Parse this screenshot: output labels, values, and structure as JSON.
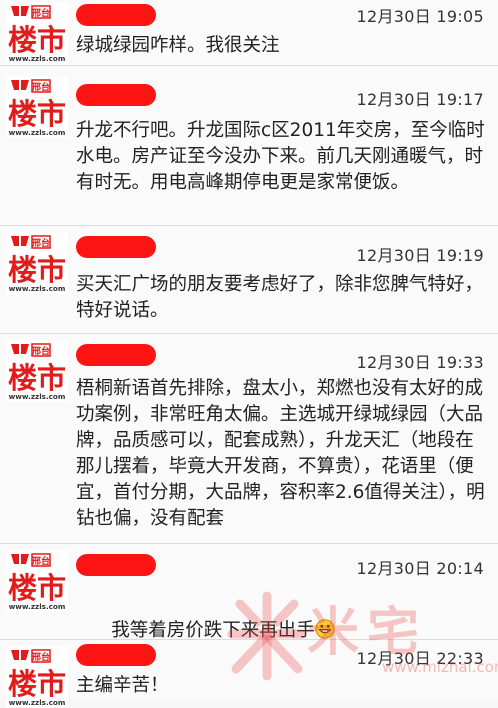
{
  "avatar_logo": {
    "top_text": "邢台",
    "brand": "楼市",
    "url": "www.zzls.com",
    "brand_color": "#e21b1b"
  },
  "messages": [
    {
      "time": "12月30日 19:05",
      "text": "绿城绿园咋样。我很关注"
    },
    {
      "time": "12月30日 19:17",
      "text": "升龙不行吧。升龙国际c区2011年交房，至今临时水电。房产证至今没办下来。前几天刚通暖气，时有时无。用电高峰期停电更是家常便饭。"
    },
    {
      "time": "12月30日 19:19",
      "text": "买天汇广场的朋友要考虑好了，除非您脾气特好，特好说话。"
    },
    {
      "time": "12月30日 19:33",
      "text": "梧桐新语首先排除，盘太小，郑燃也没有太好的成功案例，非常旺角太偏。主选城开绿城绿园（大品牌，品质感可以，配套成熟），升龙天汇（地段在那儿摆着，毕竟大开发商，不算贵），花语里（便宜，首付分期，大品牌，容积率2.6值得关注），明钻也偏，没有配套"
    },
    {
      "time": "12月30日 20:14",
      "text": "我等着房价跌下来再出手",
      "emoji": "grinning-face-icon"
    },
    {
      "time": "12月30日 22:33",
      "text": "主编辛苦！"
    }
  ],
  "watermark": {
    "brand": "米宅",
    "url": "www.mizhai.com",
    "color": "#e83c3c"
  }
}
